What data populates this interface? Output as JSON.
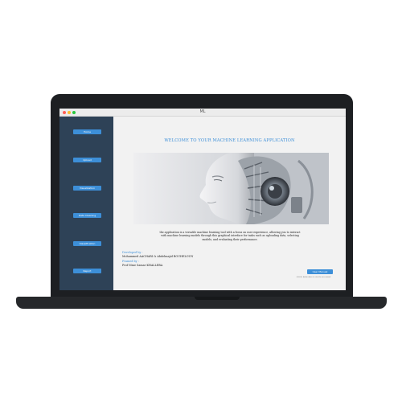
{
  "window": {
    "title": "ML"
  },
  "sidebar": {
    "items": [
      {
        "label": "Home"
      },
      {
        "label": "Upload"
      },
      {
        "label": "Visualization"
      },
      {
        "label": "Data Cleaning"
      },
      {
        "label": "Classification"
      },
      {
        "label": "Report"
      }
    ]
  },
  "main": {
    "welcome": "WELCOME TO YOUR MACHINE LEARNING APPLICATION",
    "banner": {
      "icon": "ai-robot-image"
    },
    "description": "the application is a versatile machine learning tool with a focus on user experience, allowing you to interact with machine learning models through this graphical interface for tasks such as uploading data, selecting models, and evaluating their performance.",
    "developed_label": "Developed by :",
    "developers": "Mohammed AACHARI & Abdelmajid BOUHELOUN",
    "framed_label": "Framed by :",
    "supervisor": "Prof Mme Samar KHALLEBA",
    "user_manual_label": "User Manual",
    "manual_note": "click the button above to view the user manual"
  },
  "colors": {
    "accent": "#3d8fd8",
    "sidebar": "#2e4257",
    "content_bg": "#f2f2f2",
    "laptop": "#1d1f22"
  }
}
